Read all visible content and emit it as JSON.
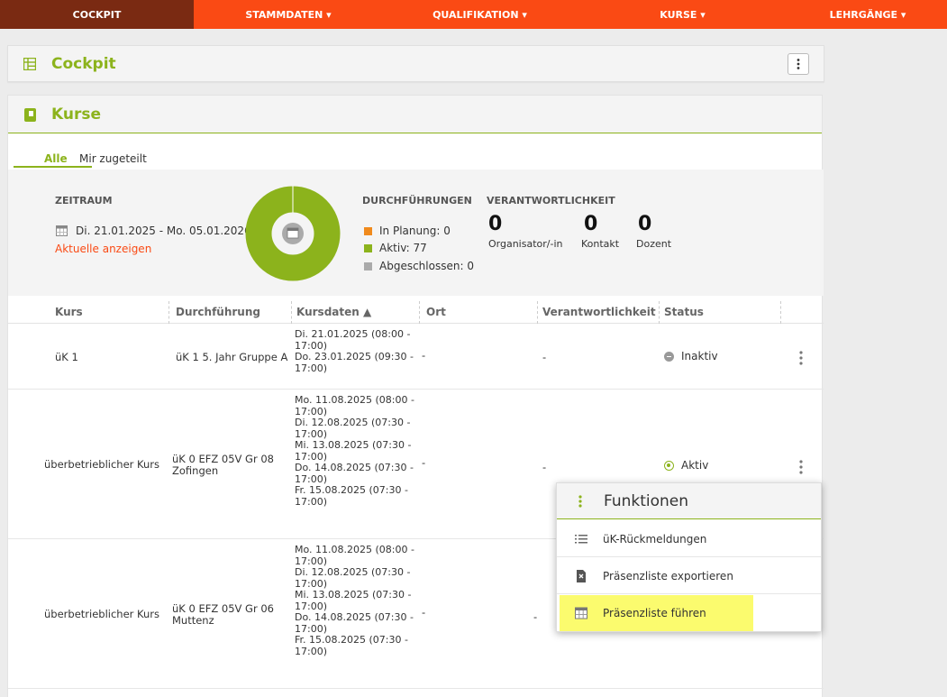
{
  "nav": {
    "items": [
      {
        "label": "COCKPIT"
      },
      {
        "label": "STAMMDATEN ▾"
      },
      {
        "label": "QUALIFIKATION ▾"
      },
      {
        "label": "KURSE ▾"
      },
      {
        "label": "LEHRGÄNGE ▾"
      }
    ],
    "active_color": "#7a2a12",
    "bar_color": "#fa4a14"
  },
  "cockpit": {
    "title": "Cockpit"
  },
  "kurse": {
    "title": "Kurse",
    "tabs": [
      {
        "label": "Alle"
      },
      {
        "label": "Mir zugeteilt"
      }
    ],
    "summary": {
      "zeitraum_label": "ZEITRAUM",
      "date_range": "Di. 21.01.2025 - Mo. 05.01.2026",
      "show_current": "Aktuelle anzeigen",
      "durchfuehrungen_label": "DURCHFÜHRUNGEN",
      "legend": [
        {
          "label": "In Planung:",
          "value": "0",
          "color": "#f08a1c"
        },
        {
          "label": "Aktiv:",
          "value": "77",
          "color": "#8cb31c"
        },
        {
          "label": "Abgeschlossen:",
          "value": "0",
          "color": "#aaaaaa"
        }
      ],
      "verantwortlichkeit_label": "VERANTWORTLICHKEIT",
      "counts": [
        {
          "value": "0",
          "label": "Organisator/-in"
        },
        {
          "value": "0",
          "label": "Kontakt"
        },
        {
          "value": "0",
          "label": "Dozent"
        }
      ]
    },
    "table": {
      "headers": [
        "Kurs",
        "Durchführung",
        "Kursdaten ▲",
        "Ort",
        "Verantwortlichkeit",
        "Status"
      ],
      "rows": [
        {
          "kurs": "üK 1",
          "durchfuehrung": [
            "üK 1 5. Jahr Gruppe A"
          ],
          "dates": [
            "Di. 21.01.2025 (08:00 -",
            "17:00)",
            "Do. 23.01.2025 (09:30 -",
            "17:00)"
          ],
          "ort": "-",
          "verantwortlichkeit": "-",
          "status": "Inaktiv"
        },
        {
          "kurs": "überbetrieblicher Kurs",
          "durchfuehrung": [
            "üK 0 EFZ 05V Gr 08",
            "Zofingen"
          ],
          "dates": [
            "Mo. 11.08.2025 (08:00 -",
            "17:00)",
            "Di. 12.08.2025 (07:30 -",
            "17:00)",
            "Mi. 13.08.2025 (07:30 -",
            "17:00)",
            "Do. 14.08.2025 (07:30 -",
            "17:00)",
            "Fr. 15.08.2025 (07:30 -",
            "17:00)"
          ],
          "ort": "-",
          "verantwortlichkeit": "-",
          "status": "Aktiv"
        },
        {
          "kurs": "überbetrieblicher Kurs",
          "durchfuehrung": [
            "üK 0 EFZ 05V Gr 06",
            "Muttenz"
          ],
          "dates": [
            "Mo. 11.08.2025 (08:00 -",
            "17:00)",
            "Di. 12.08.2025 (07:30 -",
            "17:00)",
            "Mi. 13.08.2025 (07:30 -",
            "17:00)",
            "Do. 14.08.2025 (07:30 -",
            "17:00)",
            "Fr. 15.08.2025 (07:30 -",
            "17:00)"
          ],
          "ort": "-",
          "verantwortlichkeit": "-"
        }
      ]
    }
  },
  "popup": {
    "title": "Funktionen",
    "items": [
      {
        "label": "üK-Rückmeldungen",
        "icon": "list-icon"
      },
      {
        "label": "Präsenzliste exportieren",
        "icon": "export-file-icon"
      },
      {
        "label": "Präsenzliste führen",
        "icon": "calendar-grid-icon",
        "highlighted": true
      }
    ]
  }
}
